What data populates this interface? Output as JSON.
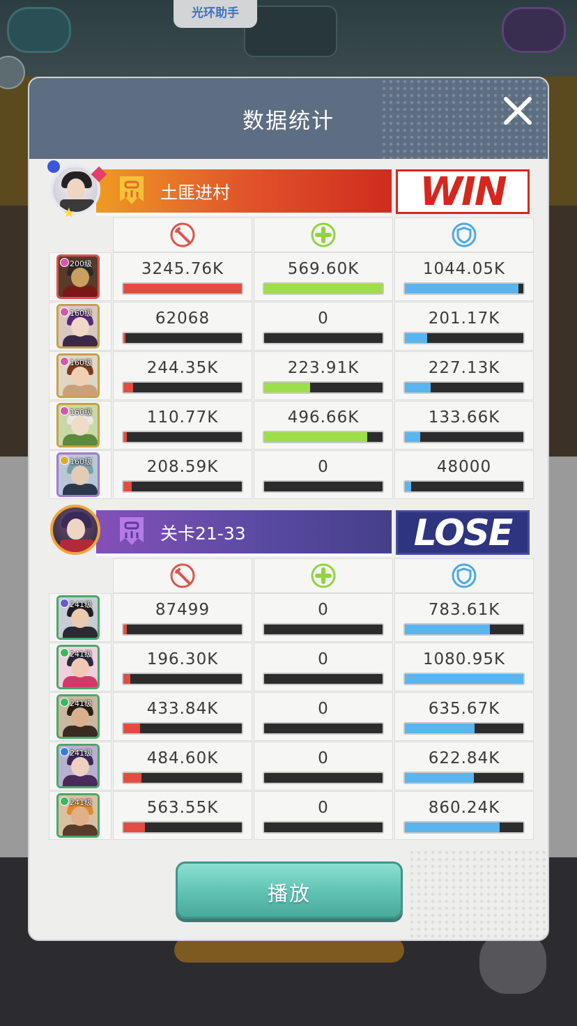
{
  "assistant_tab": "光环助手",
  "modal": {
    "title": "数据统计",
    "play_label": "播放"
  },
  "stat_icons": [
    "damage-icon",
    "heal-icon",
    "shield-icon"
  ],
  "colors": {
    "damage": "#e24d42",
    "heal": "#9ede48",
    "tank": "#5ab5ee",
    "win": "#d4271e",
    "lose": "#2e3480",
    "header": "#5e6e82",
    "play_button": "#5ec2b3"
  },
  "team1": {
    "name": "土匪进村",
    "result": "WIN",
    "heroes": [
      {
        "level": "200级",
        "faction": "heart",
        "damage": "3245.76K",
        "heal": "569.60K",
        "tank": "1044.05K",
        "damage_fill": 1.0,
        "heal_fill": 1.0,
        "tank_fill": 0.96
      },
      {
        "level": "160级",
        "faction": "heart",
        "damage": "62068",
        "heal": "0",
        "tank": "201.17K",
        "damage_fill": 0.02,
        "heal_fill": 0.0,
        "tank_fill": 0.19
      },
      {
        "level": "160级",
        "faction": "heart",
        "damage": "244.35K",
        "heal": "223.91K",
        "tank": "227.13K",
        "damage_fill": 0.08,
        "heal_fill": 0.39,
        "tank_fill": 0.22
      },
      {
        "level": "160级",
        "faction": "heart",
        "damage": "110.77K",
        "heal": "496.66K",
        "tank": "133.66K",
        "damage_fill": 0.03,
        "heal_fill": 0.87,
        "tank_fill": 0.13
      },
      {
        "level": "160级",
        "faction": "sun",
        "damage": "208.59K",
        "heal": "0",
        "tank": "48000",
        "damage_fill": 0.07,
        "heal_fill": 0.0,
        "tank_fill": 0.05
      }
    ]
  },
  "team2": {
    "name": "关卡21-33",
    "result": "LOSE",
    "heroes": [
      {
        "level": "241级",
        "faction": "moon",
        "damage": "87499",
        "heal": "0",
        "tank": "783.61K",
        "damage_fill": 0.03,
        "heal_fill": 0.0,
        "tank_fill": 0.72
      },
      {
        "level": "241级",
        "faction": "leaf",
        "damage": "196.30K",
        "heal": "0",
        "tank": "1080.95K",
        "damage_fill": 0.06,
        "heal_fill": 0.0,
        "tank_fill": 1.0
      },
      {
        "level": "241级",
        "faction": "leaf",
        "damage": "433.84K",
        "heal": "0",
        "tank": "635.67K",
        "damage_fill": 0.14,
        "heal_fill": 0.0,
        "tank_fill": 0.59
      },
      {
        "level": "241级",
        "faction": "water",
        "damage": "484.60K",
        "heal": "0",
        "tank": "622.84K",
        "damage_fill": 0.15,
        "heal_fill": 0.0,
        "tank_fill": 0.58
      },
      {
        "level": "241级",
        "faction": "leaf",
        "damage": "563.55K",
        "heal": "0",
        "tank": "860.24K",
        "damage_fill": 0.18,
        "heal_fill": 0.0,
        "tank_fill": 0.8
      }
    ]
  }
}
